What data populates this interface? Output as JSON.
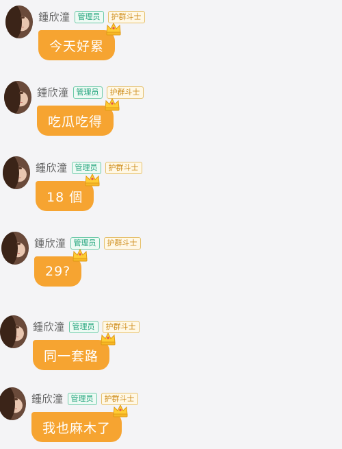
{
  "messages": [
    {
      "name": "鍾欣潼",
      "admin_badge": "管理员",
      "fan_badge": "护群斗士",
      "text": "今天好累"
    },
    {
      "name": "鍾欣潼",
      "admin_badge": "管理员",
      "fan_badge": "护群斗士",
      "text": "吃瓜吃得"
    },
    {
      "name": "鍾欣潼",
      "admin_badge": "管理员",
      "fan_badge": "护群斗士",
      "text": "18 個"
    },
    {
      "name": "鍾欣潼",
      "admin_badge": "管理员",
      "fan_badge": "护群斗士",
      "text": "29?"
    },
    {
      "name": "鍾欣潼",
      "admin_badge": "管理员",
      "fan_badge": "护群斗士",
      "text": "同一套路"
    },
    {
      "name": "鍾欣潼",
      "admin_badge": "管理员",
      "fan_badge": "护群斗士",
      "text": "我也麻木了"
    }
  ],
  "colors": {
    "bubble": "#f6a431",
    "admin_badge": "#25a57e",
    "fan_badge": "#cf8e1e",
    "background": "#f4f4f6"
  },
  "icons": {
    "crown": "crown-icon",
    "avatar": "avatar"
  }
}
